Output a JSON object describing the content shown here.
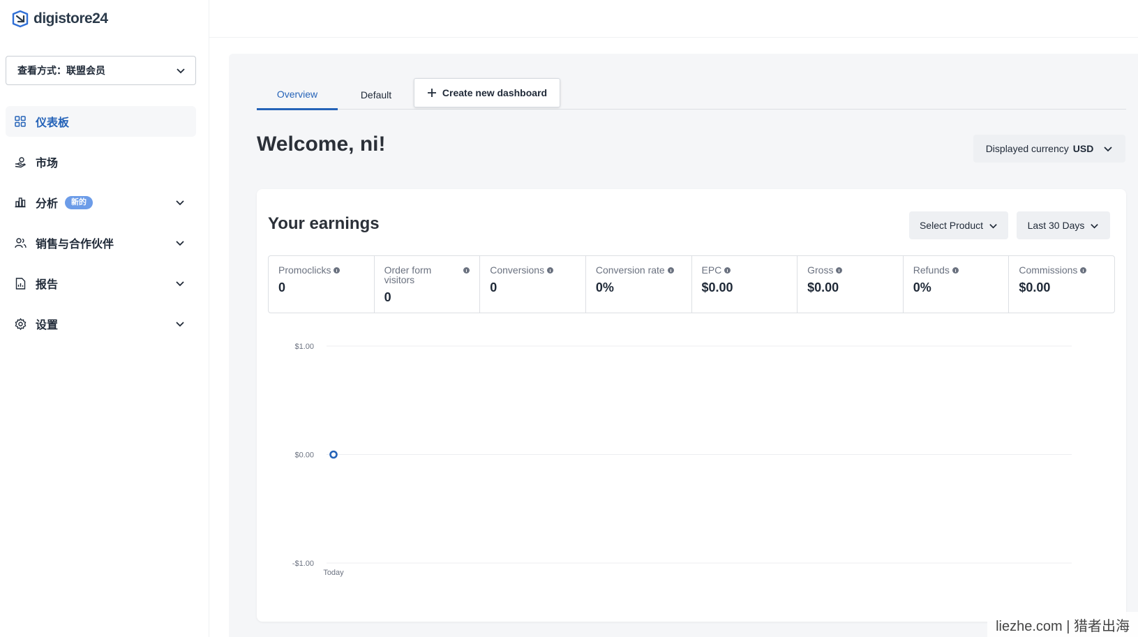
{
  "brand": {
    "name": "digistore24"
  },
  "sidebar": {
    "view_mode": "查看方式：联盟会员",
    "items": [
      {
        "label": "仪表板",
        "icon": "grid-icon"
      },
      {
        "label": "市场",
        "icon": "hand-money-icon"
      },
      {
        "label": "分析",
        "icon": "bar-chart-icon",
        "badge": "新的"
      },
      {
        "label": "销售与合作伙伴",
        "icon": "users-icon"
      },
      {
        "label": "报告",
        "icon": "report-icon"
      },
      {
        "label": "设置",
        "icon": "gear-icon"
      }
    ]
  },
  "tabs": {
    "overview": "Overview",
    "default": "Default",
    "create": "Create new dashboard"
  },
  "welcome": "Welcome, ni!",
  "currency": {
    "label": "Displayed currency",
    "value": "USD"
  },
  "earnings": {
    "title": "Your earnings",
    "product_select": "Select Product",
    "range_select": "Last 30 Days",
    "metrics": [
      {
        "label": "Promoclicks",
        "value": "0"
      },
      {
        "label": "Order form visitors",
        "value": "0"
      },
      {
        "label": "Conversions",
        "value": "0"
      },
      {
        "label": "Conversion rate",
        "value": "0%"
      },
      {
        "label": "EPC",
        "value": "$0.00"
      },
      {
        "label": "Gross",
        "value": "$0.00"
      },
      {
        "label": "Refunds",
        "value": "0%"
      },
      {
        "label": "Commissions",
        "value": "$0.00"
      }
    ]
  },
  "chart_data": {
    "type": "line",
    "x": [
      "Today"
    ],
    "series": [
      {
        "values": [
          0
        ]
      }
    ],
    "yticks": [
      "$1.00",
      "$0.00",
      "-$1.00"
    ],
    "ylim": [
      -1,
      1
    ],
    "accent": "#2563b8"
  },
  "watermark": "liezhe.com | 猎者出海",
  "colors": {
    "accent": "#2563b8",
    "badge": "#6c9ce8",
    "main_bg": "#f5f6f8"
  }
}
